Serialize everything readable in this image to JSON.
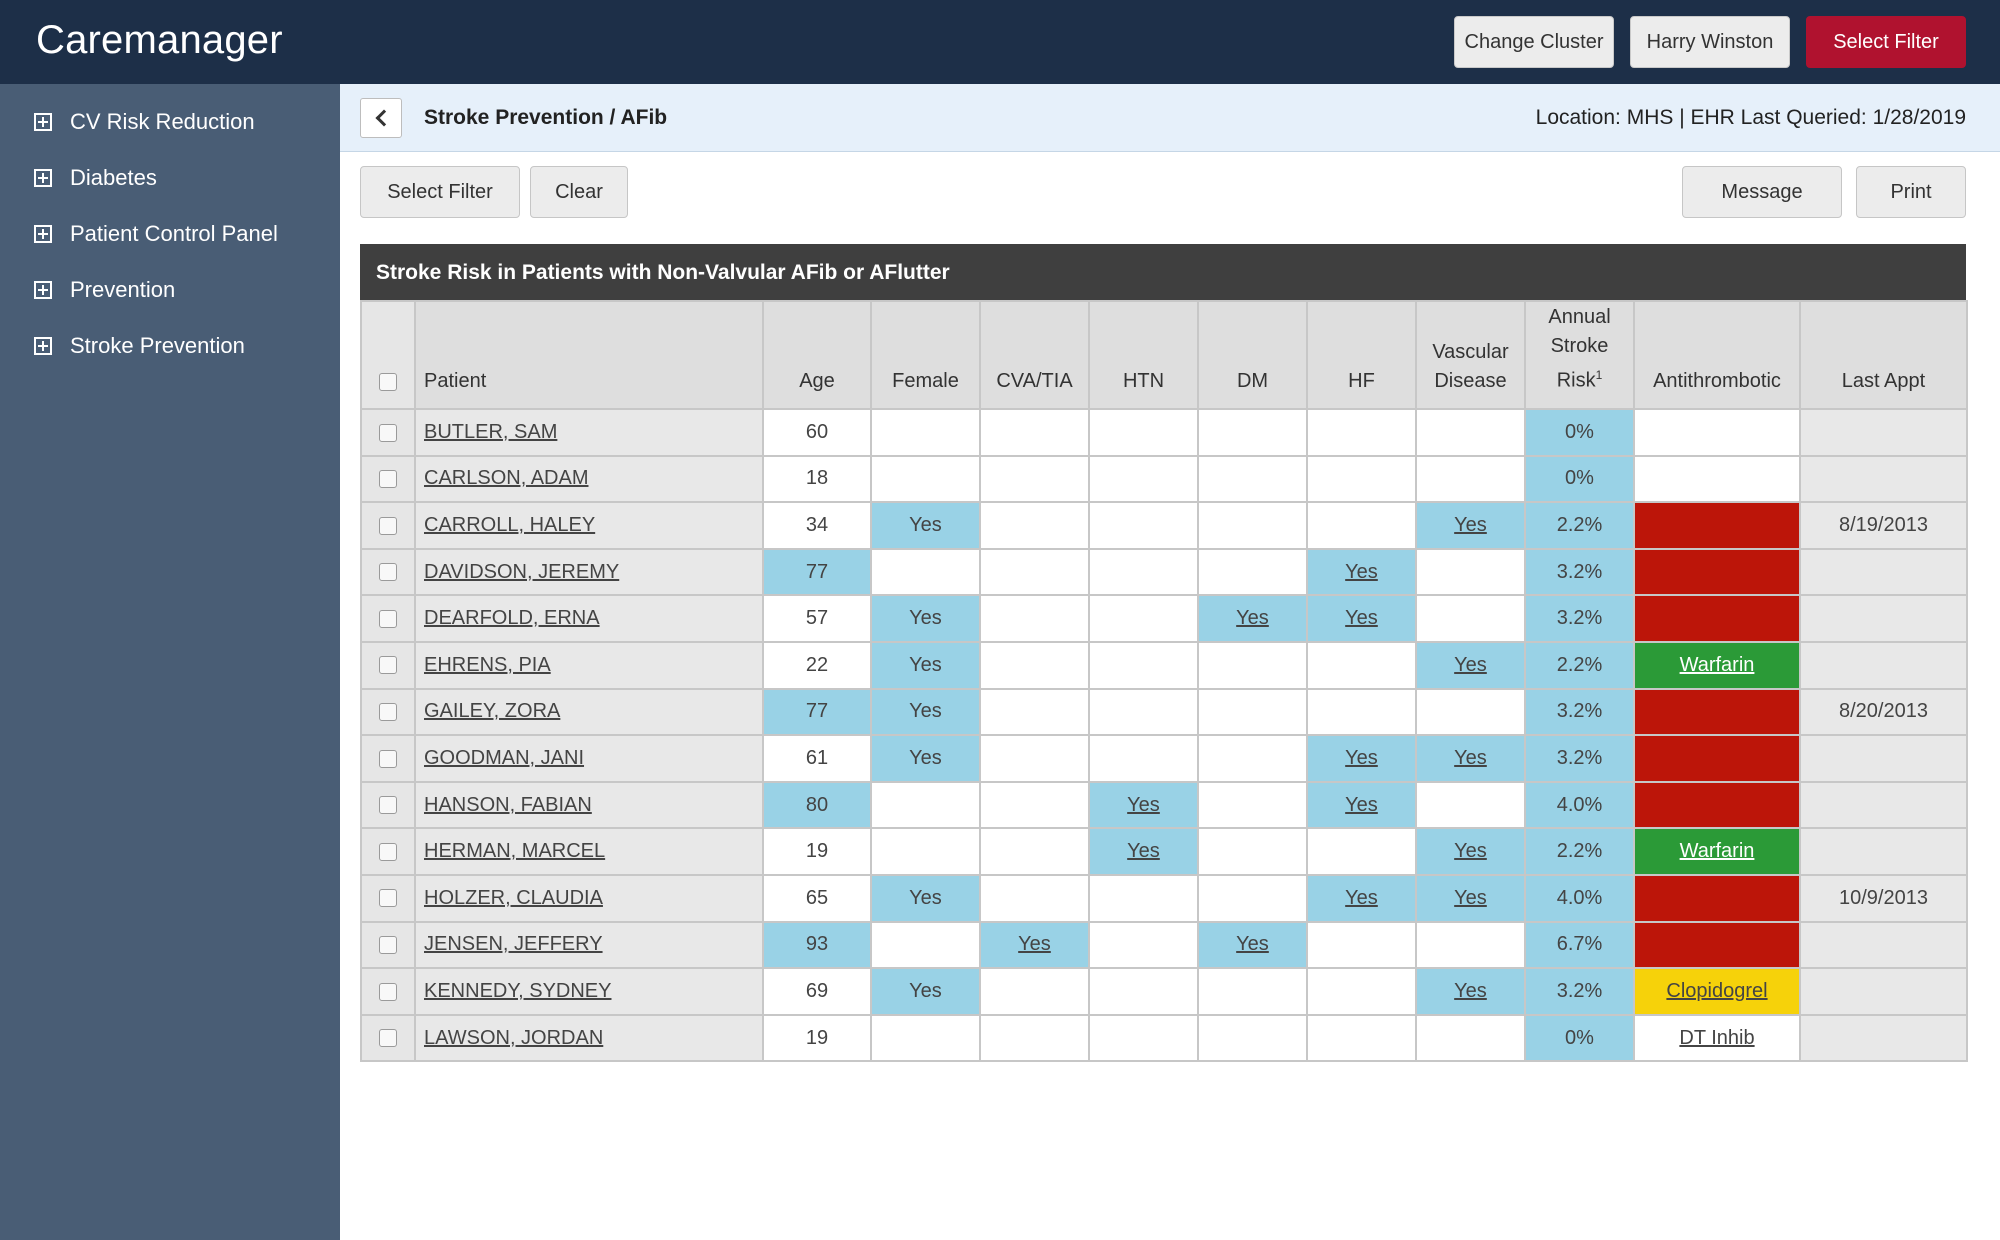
{
  "app": {
    "title": "Caremanager",
    "buttons": {
      "change_cluster": "Change Cluster",
      "user": "Harry Winston",
      "select_filter": "Select Filter"
    },
    "colors": {
      "topbar": "#1d2f48",
      "sidebar": "#495d75",
      "primary": "#b0122f"
    }
  },
  "sidebar": {
    "items": [
      {
        "label": "CV Risk Reduction",
        "icon": "plus-square-icon"
      },
      {
        "label": "Diabetes",
        "icon": "plus-square-icon"
      },
      {
        "label": "Patient Control Panel",
        "icon": "plus-square-icon"
      },
      {
        "label": "Prevention",
        "icon": "plus-square-icon"
      },
      {
        "label": "Stroke Prevention",
        "icon": "plus-square-icon"
      }
    ]
  },
  "breadcrumb": {
    "title": "Stroke Prevention / AFib",
    "info": "Location: MHS | EHR Last Queried: 1/28/2019",
    "back_icon": "chevron-left-icon"
  },
  "actions": {
    "select_filter": "Select Filter",
    "clear": "Clear",
    "message": "Message",
    "print": "Print"
  },
  "table": {
    "title": "Stroke Risk in Patients with Non-Valvular AFib or AFlutter",
    "headers": {
      "patient": "Patient",
      "age": "Age",
      "female": "Female",
      "cva": "CVA/TIA",
      "htn": "HTN",
      "dm": "DM",
      "hf": "HF",
      "vascular_1": "Vascular",
      "vascular_2": "Disease",
      "risk_1": "Annual",
      "risk_2": "Stroke",
      "risk_3": "Risk",
      "risk_sup": "1",
      "antithrombotic": "Antithrombotic",
      "last_appt": "Last Appt"
    },
    "rows": [
      {
        "name": "BUTLER, SAM",
        "age": "60",
        "age_hl": false,
        "female": "",
        "cva": "",
        "htn": "",
        "dm": "",
        "hf": "",
        "vascular": "",
        "risk": "0%",
        "anti": "",
        "anti_status": "none",
        "last_appt": ""
      },
      {
        "name": "CARLSON, ADAM",
        "age": "18",
        "age_hl": false,
        "female": "",
        "cva": "",
        "htn": "",
        "dm": "",
        "hf": "",
        "vascular": "",
        "risk": "0%",
        "anti": "",
        "anti_status": "none",
        "last_appt": ""
      },
      {
        "name": "CARROLL, HALEY",
        "age": "34",
        "age_hl": false,
        "female": "Yes",
        "cva": "",
        "htn": "",
        "dm": "",
        "hf": "",
        "vascular": "Yes",
        "risk": "2.2%",
        "anti": "",
        "anti_status": "red",
        "last_appt": "8/19/2013"
      },
      {
        "name": "DAVIDSON, JEREMY",
        "age": "77",
        "age_hl": true,
        "female": "",
        "cva": "",
        "htn": "",
        "dm": "",
        "hf": "Yes",
        "vascular": "",
        "risk": "3.2%",
        "anti": "",
        "anti_status": "red",
        "last_appt": ""
      },
      {
        "name": "DEARFOLD, ERNA",
        "age": "57",
        "age_hl": false,
        "female": "Yes",
        "cva": "",
        "htn": "",
        "dm": "Yes",
        "hf": "Yes",
        "vascular": "",
        "risk": "3.2%",
        "anti": "",
        "anti_status": "red",
        "last_appt": ""
      },
      {
        "name": "EHRENS, PIA",
        "age": "22",
        "age_hl": false,
        "female": "Yes",
        "cva": "",
        "htn": "",
        "dm": "",
        "hf": "",
        "vascular": "Yes",
        "risk": "2.2%",
        "anti": "Warfarin",
        "anti_status": "green",
        "last_appt": ""
      },
      {
        "name": "GAILEY, ZORA",
        "age": "77",
        "age_hl": true,
        "female": "Yes",
        "cva": "",
        "htn": "",
        "dm": "",
        "hf": "",
        "vascular": "",
        "risk": "3.2%",
        "anti": "",
        "anti_status": "red",
        "last_appt": "8/20/2013"
      },
      {
        "name": "GOODMAN, JANI",
        "age": "61",
        "age_hl": false,
        "female": "Yes",
        "cva": "",
        "htn": "",
        "dm": "",
        "hf": "Yes",
        "vascular": "Yes",
        "risk": "3.2%",
        "anti": "",
        "anti_status": "red",
        "last_appt": ""
      },
      {
        "name": "HANSON, FABIAN",
        "age": "80",
        "age_hl": true,
        "female": "",
        "cva": "",
        "htn": "Yes",
        "dm": "",
        "hf": "Yes",
        "vascular": "",
        "risk": "4.0%",
        "anti": "",
        "anti_status": "red",
        "last_appt": ""
      },
      {
        "name": "HERMAN, MARCEL",
        "age": "19",
        "age_hl": false,
        "female": "",
        "cva": "",
        "htn": "Yes",
        "dm": "",
        "hf": "",
        "vascular": "Yes",
        "risk": "2.2%",
        "anti": "Warfarin",
        "anti_status": "green",
        "last_appt": ""
      },
      {
        "name": "HOLZER, CLAUDIA",
        "age": "65",
        "age_hl": false,
        "female": "Yes",
        "cva": "",
        "htn": "",
        "dm": "",
        "hf": "Yes",
        "vascular": "Yes",
        "risk": "4.0%",
        "anti": "",
        "anti_status": "red",
        "last_appt": "10/9/2013"
      },
      {
        "name": "JENSEN, JEFFERY",
        "age": "93",
        "age_hl": true,
        "female": "",
        "cva": "Yes",
        "htn": "",
        "dm": "Yes",
        "hf": "",
        "vascular": "",
        "risk": "6.7%",
        "anti": "",
        "anti_status": "red",
        "last_appt": ""
      },
      {
        "name": "KENNEDY, SYDNEY",
        "age": "69",
        "age_hl": false,
        "female": "Yes",
        "cva": "",
        "htn": "",
        "dm": "",
        "hf": "",
        "vascular": "Yes",
        "risk": "3.2%",
        "anti": "Clopidogrel",
        "anti_status": "yellow",
        "last_appt": ""
      },
      {
        "name": "LAWSON, JORDAN",
        "age": "19",
        "age_hl": false,
        "female": "",
        "cva": "",
        "htn": "",
        "dm": "",
        "hf": "",
        "vascular": "",
        "risk": "0%",
        "anti": "DT Inhib",
        "anti_status": "none",
        "last_appt": ""
      }
    ],
    "status_colors": {
      "red": "#bc1509",
      "green": "#2b9a37",
      "yellow": "#f6d20a",
      "highlight": "#99d2e6"
    }
  }
}
